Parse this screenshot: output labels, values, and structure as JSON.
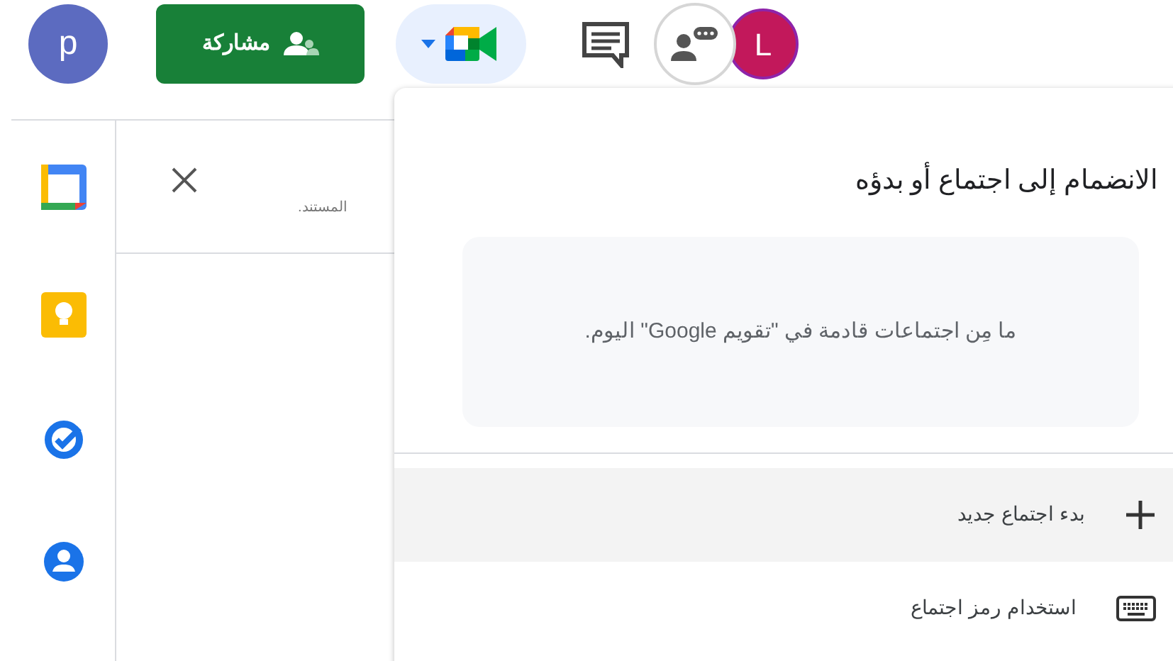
{
  "topbar": {
    "account_initial": "p",
    "share_button": "مشاركة",
    "other_account_initial": "L"
  },
  "side_panel": {
    "text": "المستند."
  },
  "meet_menu": {
    "title": "الانضمام إلى اجتماع أو بدؤه",
    "notice": "ما مِن اجتماعات قادمة في \"تقويم Google\" اليوم.",
    "items": [
      {
        "kind": "new",
        "label": "بدء اجتماع جديد",
        "selected": true
      },
      {
        "kind": "code",
        "label": "استخدام رمز اجتماع",
        "selected": false
      }
    ]
  }
}
